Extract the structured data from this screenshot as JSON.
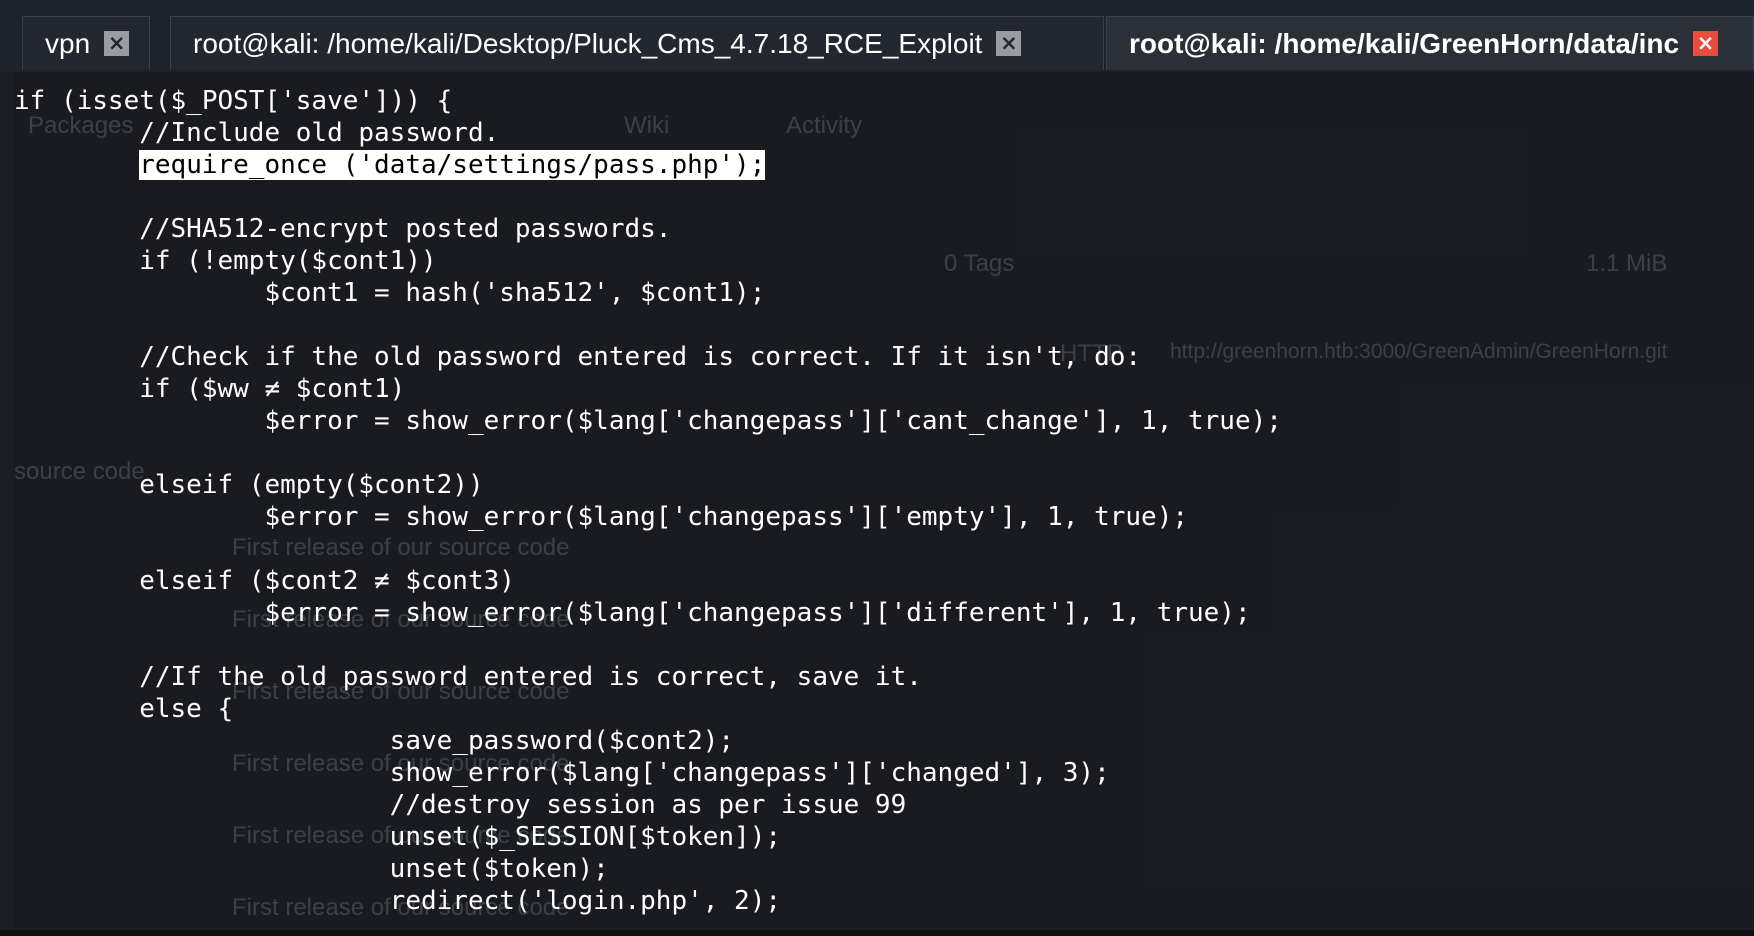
{
  "tabs": [
    {
      "label": "vpn",
      "close_icon": "×"
    },
    {
      "label": "root@kali: /home/kali/Desktop/Pluck_Cms_4.7.18_RCE_Exploit",
      "close_icon": "×"
    },
    {
      "label": "root@kali: /home/kali/GreenHorn/data/inc",
      "close_icon": "×"
    }
  ],
  "background_ghost": {
    "packages": "Packages",
    "wiki": "Wiki",
    "activity": "Activity",
    "tags": "0 Tags",
    "size": "1.1 MiB",
    "http": "HTTP",
    "url": "http://greenhorn.htb:3000/GreenAdmin/GreenHorn.git",
    "source_code_fragment": "source code",
    "commit_message": "First release of our source code"
  },
  "terminal": {
    "highlighted_line_index": 2,
    "lines": [
      "if (isset($_POST['save'])) {",
      "        //Include old password.",
      "        require_once ('data/settings/pass.php');",
      "",
      "        //SHA512-encrypt posted passwords.",
      "        if (!empty($cont1))",
      "                $cont1 = hash('sha512', $cont1);",
      "",
      "        //Check if the old password entered is correct. If it isn't, do:",
      "        if ($ww ≠ $cont1)",
      "                $error = show_error($lang['changepass']['cant_change'], 1, true);",
      "",
      "        elseif (empty($cont2))",
      "                $error = show_error($lang['changepass']['empty'], 1, true);",
      "",
      "        elseif ($cont2 ≠ $cont3)",
      "                $error = show_error($lang['changepass']['different'], 1, true);",
      "",
      "        //If the old password entered is correct, save it.",
      "        else {",
      "                        save_password($cont2);",
      "                        show_error($lang['changepass']['changed'], 3);",
      "                        //destroy session as per issue 99",
      "                        unset($_SESSION[$token]);",
      "                        unset($token);",
      "                        redirect('login.php', 2);"
    ]
  },
  "colors": {
    "terminal_bg": "#1a1c21",
    "text": "#ffffff",
    "highlight_bg": "#ffffff",
    "highlight_text": "#000000",
    "active_close": "#e74c3c",
    "inactive_close": "#9a9ca1"
  }
}
